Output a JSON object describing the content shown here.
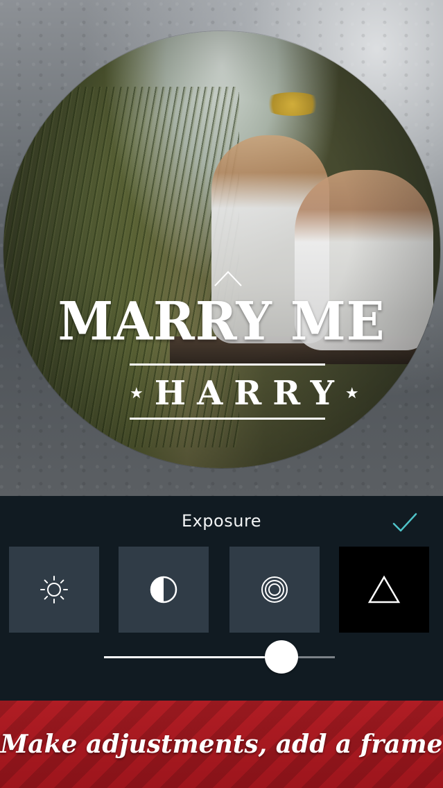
{
  "overlay": {
    "title_main": "MARRY ME",
    "title_sub": "HARRY",
    "star_glyph": "★"
  },
  "panel": {
    "title": "Exposure",
    "confirm_icon": "checkmark-icon",
    "accent_color": "#4fc3c8",
    "tools": [
      {
        "name": "brightness",
        "icon": "sun-icon",
        "active": false
      },
      {
        "name": "contrast",
        "icon": "half-circle-icon",
        "active": false
      },
      {
        "name": "vignette",
        "icon": "concentric-circles-icon",
        "active": false
      },
      {
        "name": "frame",
        "icon": "triangle-icon",
        "active": true
      }
    ],
    "slider": {
      "value": 0.77
    }
  },
  "banner": {
    "text": "Make adjustments, add a frame",
    "color": "#a8191f"
  }
}
